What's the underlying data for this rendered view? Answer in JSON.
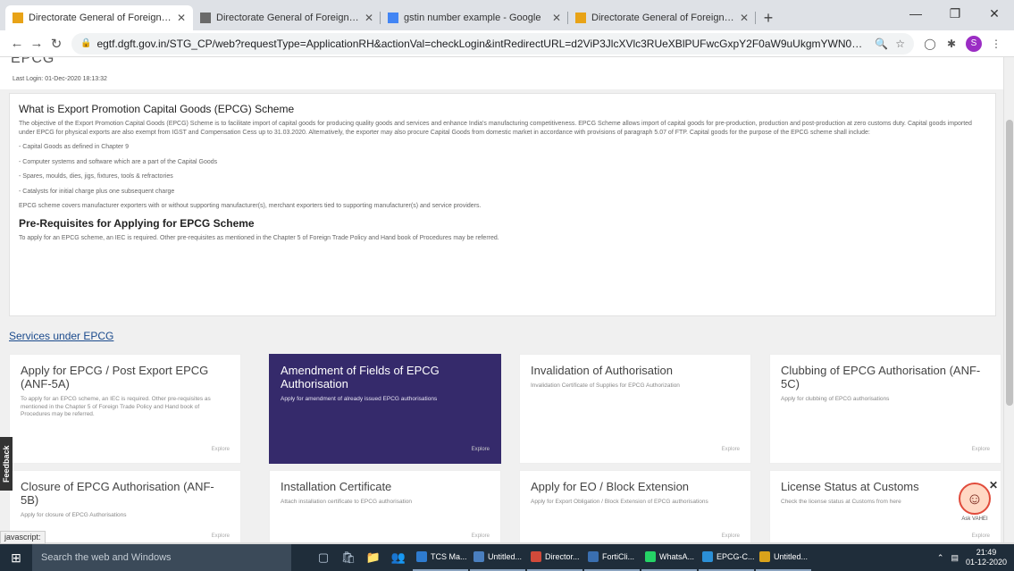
{
  "browser": {
    "tabs": [
      {
        "title": "Directorate General of Foreign Tr",
        "icon": "dgft-icon",
        "color": "#e8a317",
        "active": true
      },
      {
        "title": "Directorate General of Foreign Tr",
        "icon": "dgft-alt-icon",
        "color": "#6a6a6a",
        "active": false
      },
      {
        "title": "gstin number example - Google",
        "icon": "google-icon",
        "color": "#4285f4",
        "active": false
      },
      {
        "title": "Directorate General of Foreign Tr",
        "icon": "dgft-icon",
        "color": "#e8a317",
        "active": false
      }
    ],
    "url": "egtf.dgft.gov.in/STG_CP/web?requestType=ApplicationRH&actionVal=checkLogin&intRedirectURL=d2ViP3JlcXVlc3RUeXBlPUFwcGxpY2F0aW9uUkgmYWN0aW9u...",
    "profile_initial": "S"
  },
  "header": {
    "title": "EPCG",
    "last_login": "Last Login: 01-Dec-2020 18:13:32"
  },
  "info": {
    "heading": "What is Export Promotion Capital Goods (EPCG) Scheme",
    "para1": "The objective of the Export Promotion Capital Goods (EPCG) Scheme is to facilitate import of capital goods for producing quality goods and services and enhance India's manufacturing competitiveness. EPCG Scheme allows import of capital goods for pre-production, production and post-production at zero customs duty. Capital goods imported under EPCG for physical exports are also exempt from IGST and Compensation Cess up to 31.03.2020. Alternatively, the exporter may also procure Capital Goods from domestic market in accordance with provisions of paragraph 5.07 of FTP. Capital goods for the purpose of the EPCG scheme shall include:",
    "bullets": [
      "- Capital Goods as defined in Chapter 9",
      "- Computer systems and software which are a part of the Capital Goods",
      "- Spares, moulds, dies, jigs, fixtures, tools & refractories",
      "- Catalysts for initial charge plus one subsequent charge"
    ],
    "para2": "EPCG scheme covers manufacturer exporters with or without supporting manufacturer(s), merchant exporters tied to supporting manufacturer(s) and service providers.",
    "prereq_heading": "Pre-Requisites for Applying for EPCG Scheme",
    "prereq_text": "To apply for an EPCG scheme, an IEC is required. Other pre-requisites as mentioned in the Chapter 5 of Foreign Trade Policy and Hand book of Procedures may be referred."
  },
  "services": {
    "title": "Services under EPCG",
    "explore_label": "Explore",
    "cards": [
      {
        "title": "Apply for EPCG / Post Export EPCG (ANF-5A)",
        "desc": "To apply for an EPCG scheme, an IEC is required. Other pre-requisites as mentioned in the Chapter 5 of Foreign Trade Policy and Hand book of Procedures may be referred."
      },
      {
        "title": "Amendment of Fields of EPCG Authorisation",
        "desc": "Apply for amendment of already issued EPCG authorisations"
      },
      {
        "title": "Invalidation of Authorisation",
        "desc": "Invalidation Certificate of Supplies for EPCG Authorization"
      },
      {
        "title": "Clubbing of EPCG Authorisation (ANF-5C)",
        "desc": "Apply for clubbing of EPCG authorisations"
      },
      {
        "title": "Closure of EPCG Authorisation (ANF-5B)",
        "desc": "Apply for closure of EPCG Authorisations"
      },
      {
        "title": "Installation Certificate",
        "desc": "Attach installation certificate to EPCG authorisation"
      },
      {
        "title": "Apply for EO / Block Extension",
        "desc": "Apply for Export Obligation / Block Extension of EPCG authorisations"
      },
      {
        "title": "License Status at Customs",
        "desc": "Check the license status at Customs from here"
      }
    ]
  },
  "feedback_label": "Feedback",
  "status_text": "javascript:",
  "assistant_label": "Ask VAHEI",
  "taskbar": {
    "search_placeholder": "Search the web and Windows",
    "apps": [
      {
        "label": "TCS Ma...",
        "color": "#2e7bcf"
      },
      {
        "label": "Untitled...",
        "color": "#4a7fbf"
      },
      {
        "label": "Director...",
        "color": "#d14a3a"
      },
      {
        "label": "FortiCli...",
        "color": "#3a6fb0"
      },
      {
        "label": "WhatsA...",
        "color": "#25d366"
      },
      {
        "label": "EPCG-C...",
        "color": "#2b8fd6"
      },
      {
        "label": "Untitled...",
        "color": "#d9a21b"
      }
    ],
    "time": "21:49",
    "date": "01-12-2020"
  }
}
